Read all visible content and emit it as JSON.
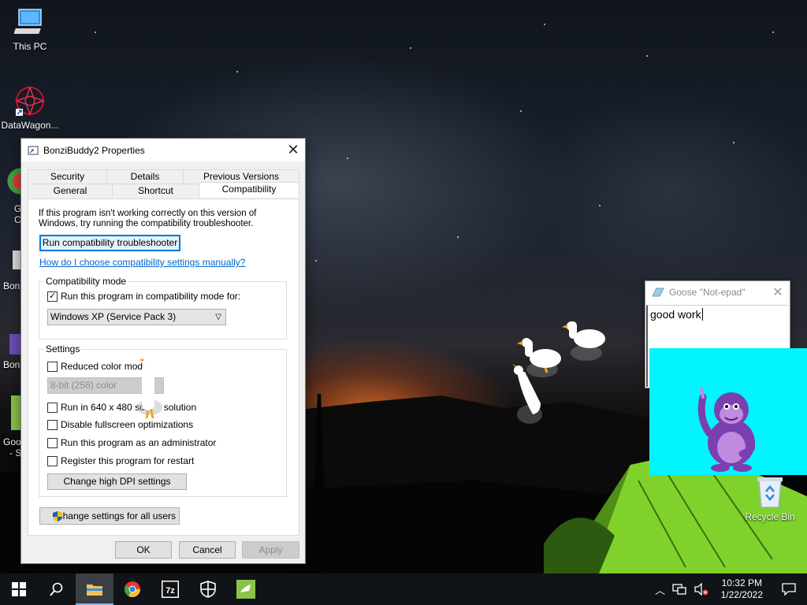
{
  "desktop": {
    "icons": [
      {
        "label": "This PC"
      },
      {
        "label": "DataWagon..."
      }
    ],
    "partial_labels": [
      "G",
      "C",
      "Bon",
      "Bon",
      "Goo",
      "- S"
    ],
    "recycle_bin": "Recycle Bin"
  },
  "dialog": {
    "title": "BonziBuddy2 Properties",
    "tabs_row1": [
      "Security",
      "Details",
      "Previous Versions"
    ],
    "tabs_row2": [
      "General",
      "Shortcut",
      "Compatibility"
    ],
    "active_tab": "Compatibility",
    "intro": "If this program isn't working correctly on this version of Windows, try running the compatibility troubleshooter.",
    "troubleshooter_button": "Run compatibility troubleshooter",
    "manual_link": "How do I choose compatibility settings manually?",
    "compat_mode": {
      "group_title": "Compatibility mode",
      "checkbox_label": "Run this program in compatibility mode for:",
      "checked": true,
      "selected_os": "Windows XP (Service Pack 3)"
    },
    "settings": {
      "group_title": "Settings",
      "reduced_color": "Reduced color mode",
      "color_select": "8-bit (256) color",
      "run_640": "Run in 640 x 480 scre",
      "run_640_tail": "solution",
      "disable_fullscreen": "Disable fullscreen optimizations",
      "run_admin": "Run this program as an administrator",
      "register_restart": "Register this program for restart",
      "dpi_button": "Change high DPI settings"
    },
    "all_users_button": "Change settings for all users",
    "ok": "OK",
    "cancel": "Cancel",
    "apply": "Apply"
  },
  "notepad": {
    "title": "Goose \"Not-epad\"",
    "text": "good work"
  },
  "taskbar": {
    "apps": [
      "Start",
      "Search",
      "File Explorer",
      "Chrome",
      "7-Zip",
      "Security",
      "BonziBuddy"
    ],
    "time": "10:32 PM",
    "date": "1/22/2022"
  },
  "colors": {
    "accent": "#0078d7",
    "link": "#0066cc",
    "bonzi_bg": "#00f5ff",
    "taskbar": "#101418"
  }
}
